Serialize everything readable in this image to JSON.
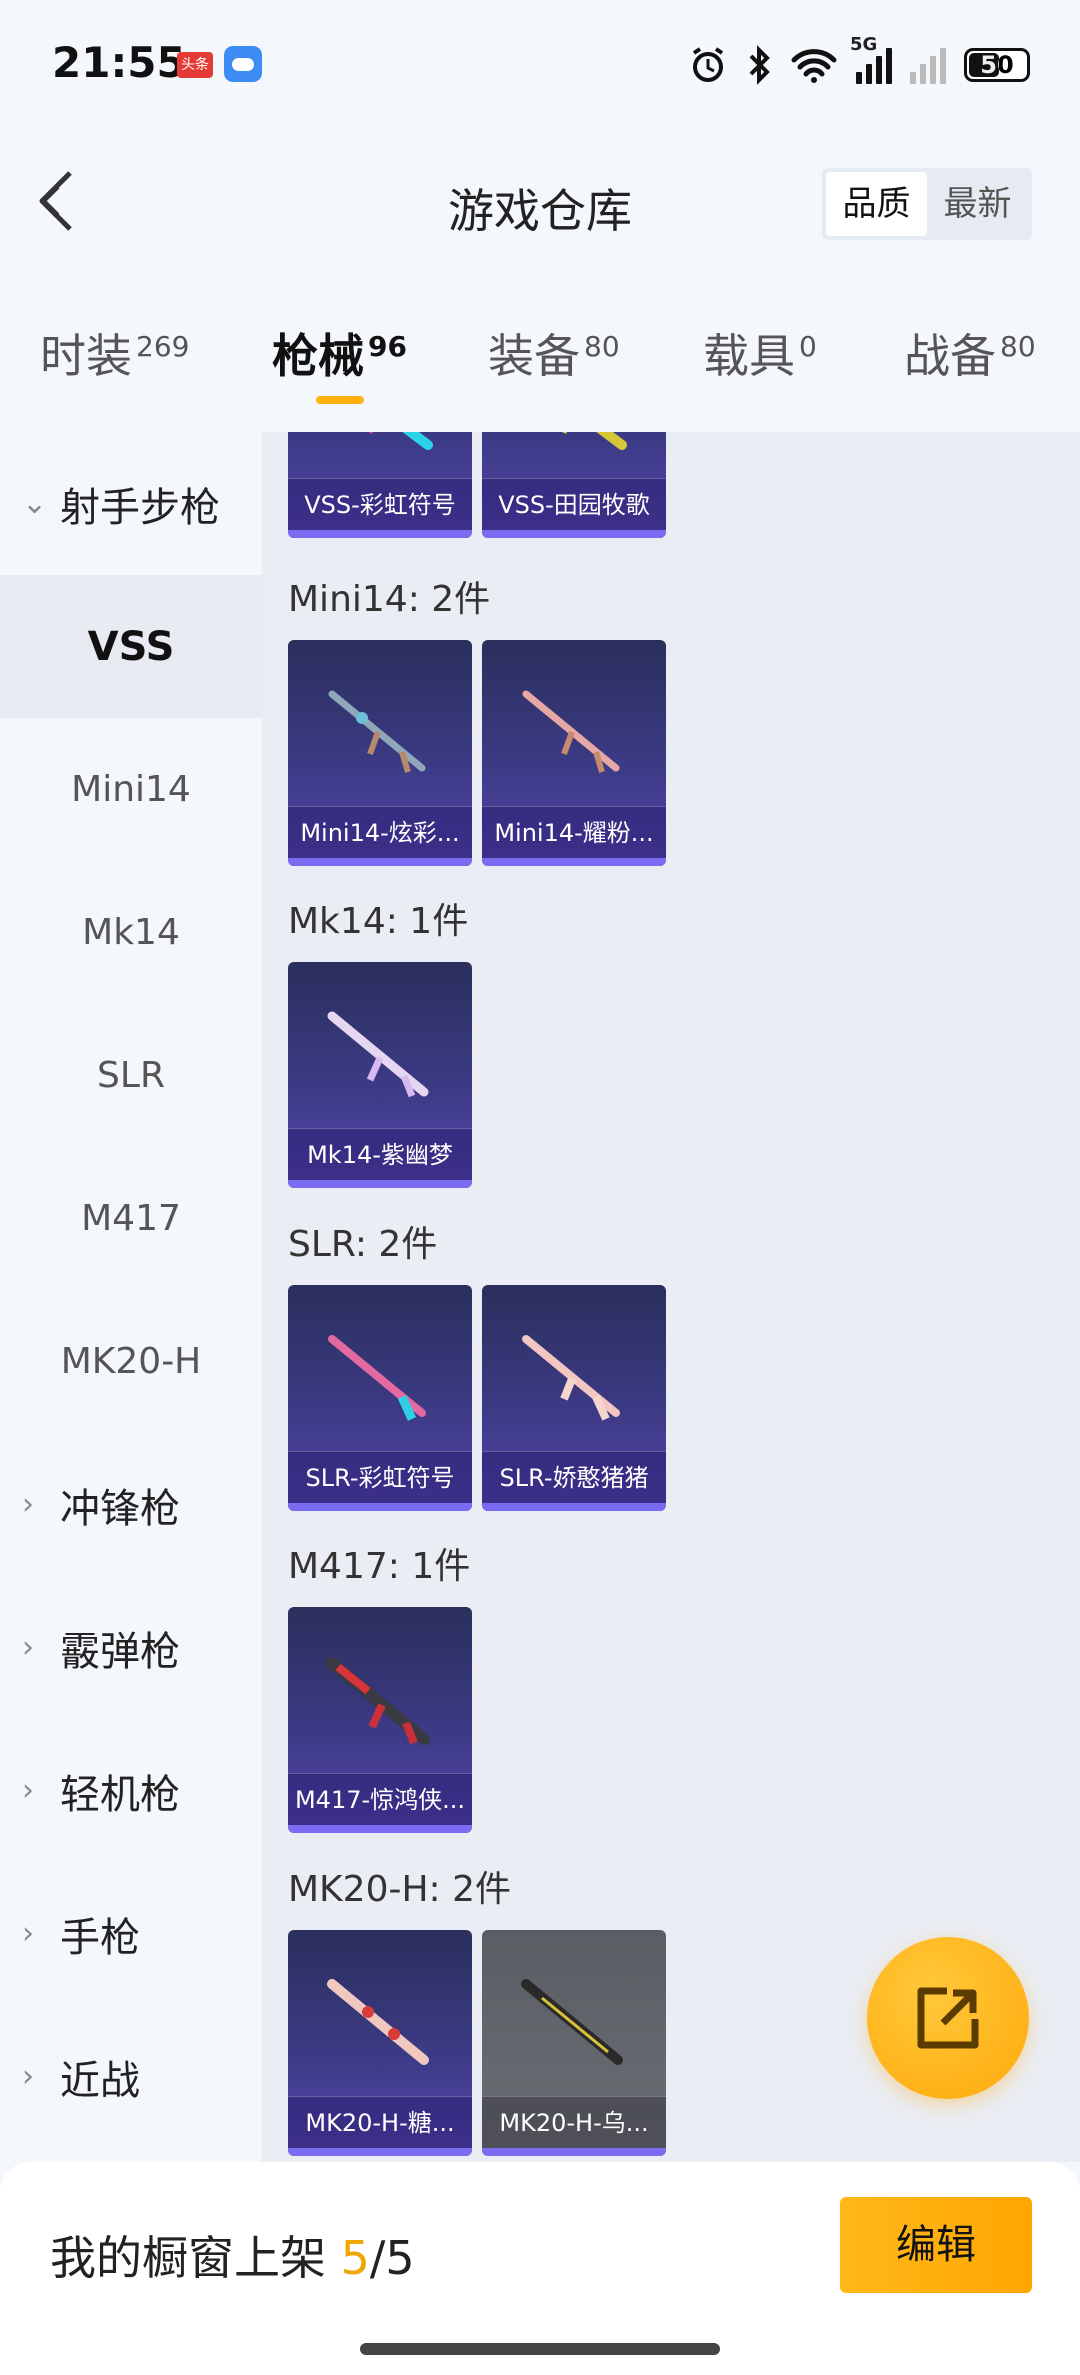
{
  "status_bar": {
    "time": "21:55",
    "app_badge": "头条",
    "network": "5G",
    "battery": "50",
    "icons": [
      "alarm-icon",
      "bluetooth-icon",
      "wifi-icon",
      "signal-5g-icon",
      "signal-icon",
      "battery-icon"
    ]
  },
  "header": {
    "title": "游戏仓库",
    "sort_options": [
      "品质",
      "最新"
    ],
    "sort_selected": "品质"
  },
  "tabs": [
    {
      "label": "时装",
      "count": "269"
    },
    {
      "label": "枪械",
      "count": "96",
      "active": true
    },
    {
      "label": "装备",
      "count": "80"
    },
    {
      "label": "载具",
      "count": "0"
    },
    {
      "label": "战备",
      "count": "80"
    }
  ],
  "sidebar": {
    "items": [
      {
        "label": "射手步枪",
        "type": "group",
        "expanded": true
      },
      {
        "label": "VSS",
        "type": "sub",
        "active": true
      },
      {
        "label": "Mini14",
        "type": "sub"
      },
      {
        "label": "Mk14",
        "type": "sub"
      },
      {
        "label": "SLR",
        "type": "sub"
      },
      {
        "label": "M417",
        "type": "sub"
      },
      {
        "label": "MK20-H",
        "type": "sub"
      },
      {
        "label": "冲锋枪",
        "type": "group"
      },
      {
        "label": "霰弹枪",
        "type": "group"
      },
      {
        "label": "轻机枪",
        "type": "group"
      },
      {
        "label": "手枪",
        "type": "group"
      },
      {
        "label": "近战",
        "type": "group"
      }
    ]
  },
  "content": {
    "sections": [
      {
        "title": "",
        "items": [
          "VSS-彩虹符号",
          "VSS-田园牧歌"
        ]
      },
      {
        "title": "Mini14: 2件",
        "items": [
          "Mini14-炫彩...",
          "Mini14-耀粉..."
        ]
      },
      {
        "title": "Mk14: 1件",
        "items": [
          "Mk14-紫幽梦"
        ]
      },
      {
        "title": "SLR: 2件",
        "items": [
          "SLR-彩虹符号",
          "SLR-娇憨猪猪"
        ]
      },
      {
        "title": "M417: 1件",
        "items": [
          "M417-惊鸿侠..."
        ]
      },
      {
        "title": "MK20-H: 2件",
        "items": [
          "MK20-H-糖...",
          "MK20-H-乌..."
        ]
      }
    ]
  },
  "bottom_bar": {
    "showcase_label": "我的橱窗上架 ",
    "showcase_current": "5",
    "showcase_total": "/5",
    "edit_label": "编辑"
  },
  "colors": {
    "accent": "#ffb20f",
    "card_bg": "#3c3a85",
    "page_bg": "#f4f7fc",
    "content_bg": "#eaedf3"
  }
}
